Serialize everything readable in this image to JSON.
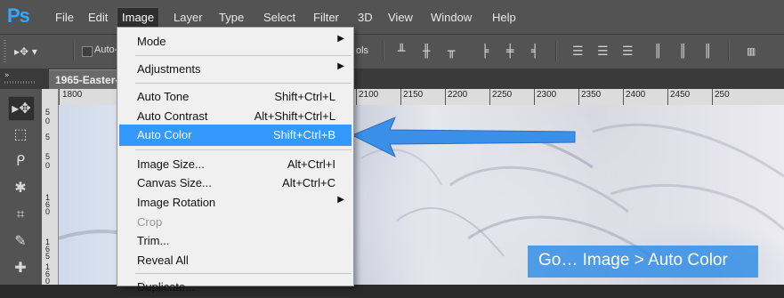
{
  "app": {
    "logo": "Ps"
  },
  "menubar": {
    "items": [
      "File",
      "Edit",
      "Image",
      "Layer",
      "Type",
      "Select",
      "Filter",
      "3D",
      "View",
      "Window",
      "Help"
    ],
    "active": "Image"
  },
  "options": {
    "checkbox_label": "Auto-",
    "trailing_label": "ols"
  },
  "document": {
    "tab_title": "1965-Easter-"
  },
  "ruler": {
    "h_labels": [
      "1800",
      "2100",
      "2150",
      "2200",
      "2250",
      "2300",
      "2350",
      "2400",
      "2450",
      "250"
    ],
    "v_labels": [
      "5",
      "0",
      "5",
      "5",
      "0",
      "1",
      "6",
      "0",
      "1",
      "6",
      "5",
      "1",
      "6",
      "0"
    ]
  },
  "image_menu": {
    "items": [
      {
        "label": "Mode",
        "shortcut": "",
        "submenu": true
      },
      {
        "label": "Adjustments",
        "shortcut": "",
        "submenu": true
      },
      {
        "label": "Auto Tone",
        "shortcut": "Shift+Ctrl+L"
      },
      {
        "label": "Auto Contrast",
        "shortcut": "Alt+Shift+Ctrl+L"
      },
      {
        "label": "Auto Color",
        "shortcut": "Shift+Ctrl+B",
        "highlighted": true
      },
      {
        "label": "Image Size...",
        "shortcut": "Alt+Ctrl+I"
      },
      {
        "label": "Canvas Size...",
        "shortcut": "Alt+Ctrl+C"
      },
      {
        "label": "Image Rotation",
        "shortcut": "",
        "submenu": true
      },
      {
        "label": "Crop",
        "shortcut": "",
        "disabled": true
      },
      {
        "label": "Trim...",
        "shortcut": ""
      },
      {
        "label": "Reveal All",
        "shortcut": ""
      },
      {
        "label": "Duplicate...",
        "shortcut": ""
      }
    ]
  },
  "callout": {
    "text": "Go… Image > Auto Color"
  },
  "colors": {
    "highlight": "#3399ff",
    "arrow": "#3a8fe8",
    "ps_blue": "#31a8ff",
    "chrome": "#535353"
  },
  "tools": [
    "move-tool-icon",
    "marquee-tool-icon",
    "lasso-tool-icon",
    "magic-wand-tool-icon",
    "crop-tool-icon",
    "eyedropper-tool-icon",
    "healing-brush-tool-icon"
  ]
}
